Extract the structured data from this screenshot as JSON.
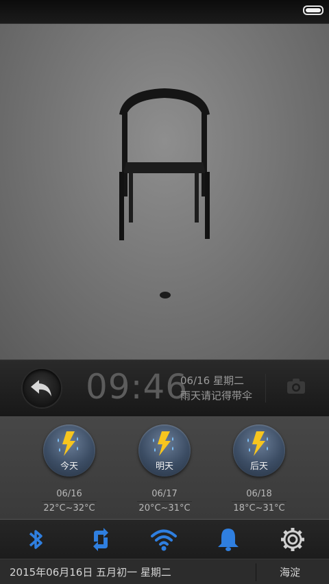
{
  "status_bar": {
    "battery_level": 1.0,
    "battery_icon": "battery-full-icon"
  },
  "wallpaper": {
    "subject": "chair"
  },
  "clock": {
    "time": "09:46",
    "date": "06/16 星期二",
    "tip": "雨天请记得带伞"
  },
  "forecast": [
    {
      "day": "今天",
      "date": "06/16",
      "temp": "22°C~32°C",
      "icon": "thunderstorm-icon"
    },
    {
      "day": "明天",
      "date": "06/17",
      "temp": "20°C~31°C",
      "icon": "thunderstorm-icon"
    },
    {
      "day": "后天",
      "date": "06/18",
      "temp": "18°C~31°C",
      "icon": "thunderstorm-icon"
    }
  ],
  "toggles": [
    {
      "name": "bluetooth-icon",
      "color": "#2f7fe0"
    },
    {
      "name": "sync-icon",
      "color": "#2f7fe0"
    },
    {
      "name": "wifi-icon",
      "color": "#2f7fe0"
    },
    {
      "name": "bell-icon",
      "color": "#2f7fe0"
    },
    {
      "name": "gear-icon",
      "color": "#d0d0d0"
    }
  ],
  "info_bar": {
    "date_text": "2015年06月16日  五月初一   星期二",
    "location": "海淀"
  },
  "colors": {
    "accent_blue": "#2f7fe0",
    "lightning_yellow": "#f7c51e"
  }
}
